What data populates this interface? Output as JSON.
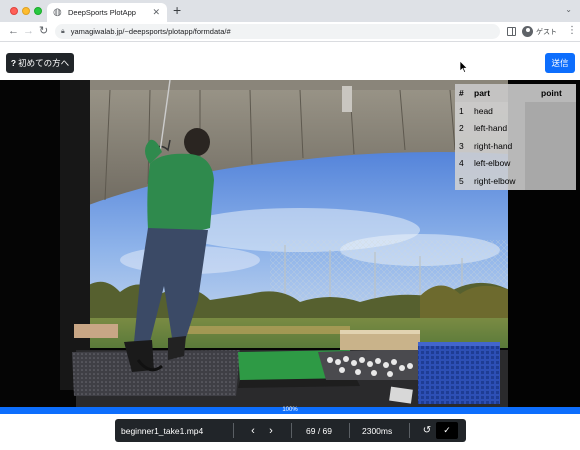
{
  "browser": {
    "tab_title": "DeepSports PlotApp",
    "tab_close": "✕",
    "new_tab": "+",
    "url": "yamagiwalab.jp/~deepsports/plotapp/formdata/#",
    "profile_label": "ゲスト",
    "icons": [
      "globe-icon",
      "close-icon",
      "plus-icon",
      "back-icon",
      "forward-icon",
      "reload-icon",
      "lock-icon",
      "side-panel-icon",
      "profile-icon",
      "menu-icon",
      "chevron-down-icon"
    ]
  },
  "header": {
    "beginner_label": "初めての方へ",
    "beginner_icon": "?",
    "submit_label": "送信",
    "colors": {
      "dark": "#212529",
      "primary": "#0d6efd"
    }
  },
  "parts_table": {
    "headers": {
      "index": "#",
      "part": "part",
      "point": "point"
    },
    "rows": [
      {
        "index": "1",
        "part": "head",
        "point": ""
      },
      {
        "index": "2",
        "part": "left-hand",
        "point": ""
      },
      {
        "index": "3",
        "part": "right-hand",
        "point": ""
      },
      {
        "index": "4",
        "part": "left-elbow",
        "point": ""
      },
      {
        "index": "5",
        "part": "right-elbow",
        "point": ""
      }
    ]
  },
  "progress": {
    "value": 1.0,
    "label": "100%"
  },
  "controls": {
    "filename": "beginner1_take1.mp4",
    "prev_icon": "‹",
    "next_icon": "›",
    "frame": "69 / 69",
    "time": "2300ms",
    "undo_icon": "↺",
    "confirm_icon": "✓"
  }
}
